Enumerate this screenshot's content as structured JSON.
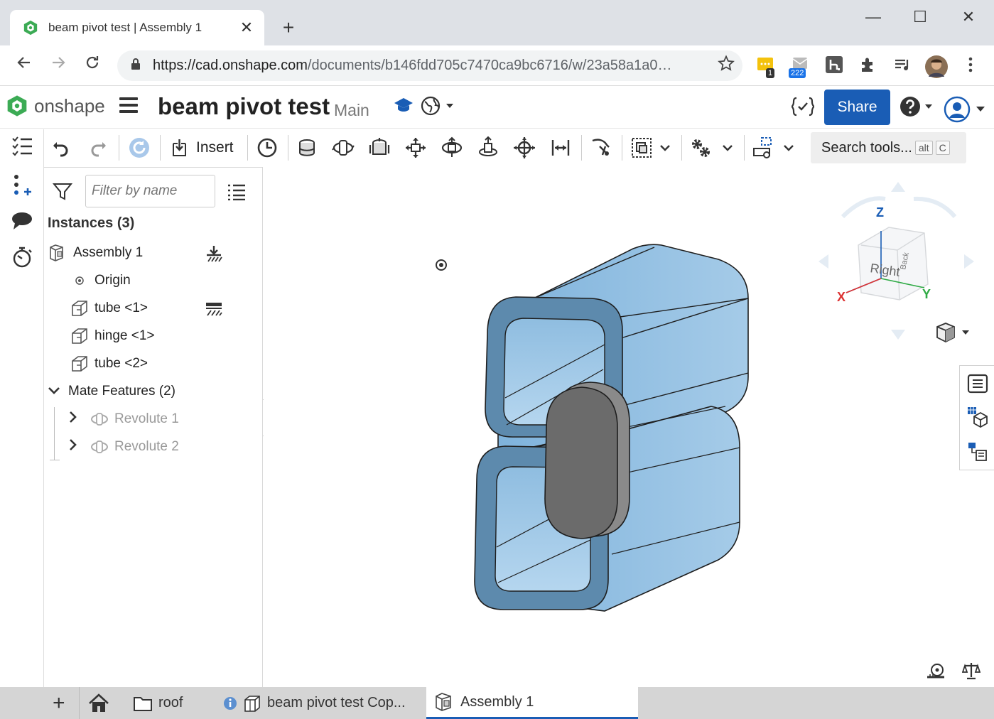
{
  "browser": {
    "tab_title": "beam pivot test | Assembly 1",
    "tab_close": "✕",
    "new_tab": "+",
    "url_main": "https://cad.onshape.com",
    "url_rest": "/documents/b146fdd705c7470ca9bc6716/w/23a58a1a0…",
    "ext_badge_1": "1",
    "ext_badge_2": "222",
    "window_min": "—",
    "window_max": "☐",
    "window_close": "✕"
  },
  "header": {
    "brand": "onshape",
    "document_title": "beam pivot test",
    "branch": "Main",
    "share_label": "Share"
  },
  "toolbar": {
    "insert_label": "Insert",
    "search_placeholder": "Search tools...",
    "search_key_1": "alt",
    "search_key_2": "C"
  },
  "panel": {
    "filter_placeholder": "Filter by name",
    "instances_header": "Instances (3)",
    "items": [
      {
        "label": "Assembly 1"
      },
      {
        "label": "Origin"
      },
      {
        "label": "tube <1>"
      },
      {
        "label": "hinge <1>"
      },
      {
        "label": "tube <2>"
      }
    ],
    "mate_features_label": "Mate Features (2)",
    "mates": [
      {
        "label": "Revolute 1"
      },
      {
        "label": "Revolute 2"
      }
    ]
  },
  "viewcube": {
    "axis_z": "Z",
    "axis_x": "X",
    "axis_y": "Y",
    "face_right": "Right",
    "face_back": "Back"
  },
  "bottom_tabs": {
    "add": "+",
    "folder": "roof",
    "linked_doc": "beam pivot test Cop...",
    "active_tab": "Assembly 1"
  },
  "colors": {
    "brand_blue": "#1a5db5",
    "part_blue": "#8fbde0",
    "hinge_gray": "#6b6b6b"
  }
}
